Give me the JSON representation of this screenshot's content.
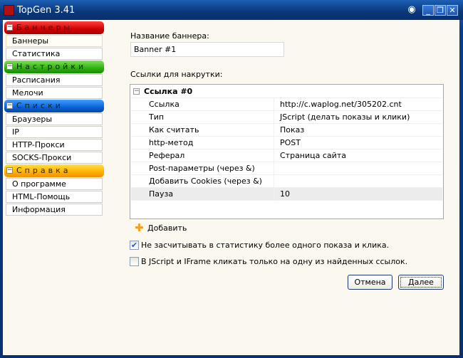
{
  "window": {
    "title": "TopGen 3.41"
  },
  "sidebar": {
    "groups": [
      {
        "label": "Баннеры",
        "color": "#d00000",
        "items": [
          "Баннеры",
          "Статистика"
        ]
      },
      {
        "label": "Настройки",
        "color": "#30b010",
        "items": [
          "Расписания",
          "Мелочи"
        ]
      },
      {
        "label": "Списки",
        "color": "#0862d8",
        "items": [
          "Браузеры",
          "IP",
          "HTTP-Прокси",
          "SOCKS-Прокси"
        ]
      },
      {
        "label": "Справка",
        "color": "#ffb000",
        "items": [
          "О программе",
          "HTML-Помощь",
          "Информация"
        ]
      }
    ]
  },
  "main": {
    "banner_name_label": "Название баннера:",
    "banner_name_value": "Banner #1",
    "links_label": "Ссылки для накрутки:",
    "grid": {
      "group": "Ссылка #0",
      "rows": [
        {
          "k": "Ссылка",
          "v": "http://c.waplog.net/305202.cnt"
        },
        {
          "k": "Тип",
          "v": "JScript (делать показы и клики)"
        },
        {
          "k": "Как считать",
          "v": "Показ"
        },
        {
          "k": "http-метод",
          "v": "POST"
        },
        {
          "k": "Реферал",
          "v": "Страница сайта"
        },
        {
          "k": "Post-параметры (через &)",
          "v": ""
        },
        {
          "k": "Добавить Cookies (через &)",
          "v": ""
        },
        {
          "k": "Пауза",
          "v": "10"
        }
      ]
    },
    "add_label": "Добавить",
    "check1": {
      "label": "Не засчитывать в статистику более одного показа и клика.",
      "checked": true
    },
    "check2": {
      "label": "В JScript и IFrame кликать только на одну из найденных ссылок.",
      "checked": false
    },
    "cancel": "Отмена",
    "next": "Далее"
  }
}
